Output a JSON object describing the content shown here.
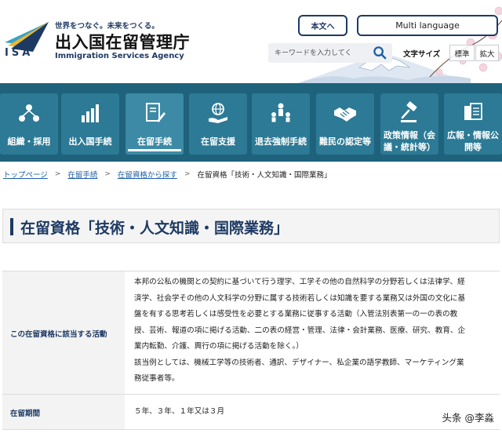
{
  "header": {
    "logo_text": "ISA",
    "tagline": "世界をつなぐ。未来をつくる。",
    "agency_name_jp": "出入国在留管理庁",
    "agency_name_en": "Immigration Services Agency",
    "body_text_button": "本文へ",
    "language_button": "Multi language",
    "search_placeholder": "キーワードを入力してく",
    "font_size_label": "文字サイズ",
    "font_size_standard": "標準",
    "font_size_large": "拡大"
  },
  "nav": {
    "items": [
      {
        "label": "組織・採用",
        "icon": "people-network-icon"
      },
      {
        "label": "出入国手続",
        "icon": "bar-chart-icon"
      },
      {
        "label": "在留手続",
        "icon": "document-pen-icon",
        "active": true
      },
      {
        "label": "在留支援",
        "icon": "globe-hand-icon"
      },
      {
        "label": "退去強制手続",
        "icon": "group-presenter-icon"
      },
      {
        "label": "難民の認定等",
        "icon": "handshake-icon"
      },
      {
        "label": "政策情報（会議・統計等）",
        "line1": "政策情報（会",
        "line2": "議・統計等）",
        "icon": "gavel-icon"
      },
      {
        "label": "広報・情報公開等",
        "line1": "広報・情報公",
        "line2": "開等",
        "icon": "documents-icon"
      }
    ]
  },
  "breadcrumb": {
    "items": [
      "トップページ",
      "在留手続",
      "在留資格から探す"
    ],
    "current": "在留資格「技術・人文知識・国際業務」"
  },
  "page_title": "在留資格「技術・人文知識・国際業務」",
  "table": {
    "rows": [
      {
        "head": "この在留資格に該当する活動",
        "lines": [
          "本邦の公私の機関との契約に基づいて行う理学、工学その他の自然科学の分野若しくは法律学、経",
          "済学、社会学その他の人文科学の分野に属する技術若しくは知識を要する業務又は外国の文化に基",
          "盤を有する思考若しくは感受性を必要とする業務に従事する活動（入管法別表第一の一の表の教",
          "授、芸術、報道の項に掲げる活動、二の表の経営・管理、法律・会計業務、医療、研究、教育、企",
          "業内転勤、介護、興行の項に掲げる活動を除く。）",
          "該当例としては、機械工学等の技術者、通訳、デザイナー、私企業の語学教師、マーケティング業",
          "務従事者等。"
        ]
      },
      {
        "head": "在留期間",
        "lines": [
          "５年、３年、１年又は３月"
        ]
      }
    ]
  },
  "watermark": "头条 @李淼",
  "colors": {
    "navy": "#1e3a63",
    "nav_bg": "#1e627c",
    "nav_tile": "#2c7a95",
    "link": "#1d5fa8"
  }
}
